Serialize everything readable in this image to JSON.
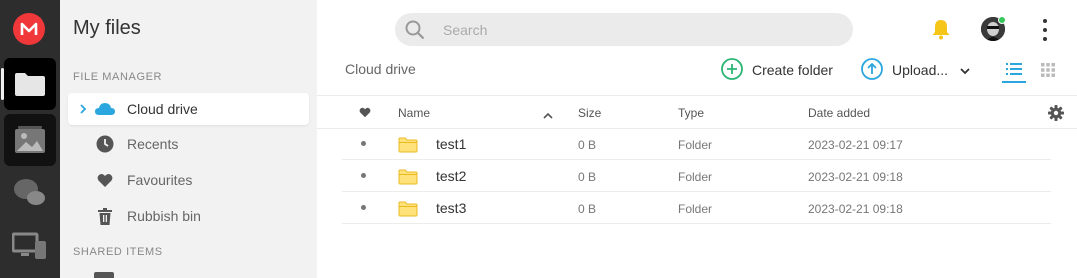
{
  "sidebar": {
    "title": "My files",
    "file_manager_label": "FILE MANAGER",
    "items": [
      {
        "label": "Cloud drive",
        "icon": "cloud-icon"
      },
      {
        "label": "Recents",
        "icon": "clock-icon"
      },
      {
        "label": "Favourites",
        "icon": "heart-icon"
      },
      {
        "label": "Rubbish bin",
        "icon": "trash-icon"
      }
    ],
    "shared_label": "SHARED ITEMS"
  },
  "topbar": {
    "search_placeholder": "Search"
  },
  "toolbar": {
    "breadcrumb": "Cloud drive",
    "create_folder_label": "Create folder",
    "upload_label": "Upload..."
  },
  "table": {
    "columns": {
      "name": "Name",
      "size": "Size",
      "type": "Type",
      "date": "Date added"
    },
    "rows": [
      {
        "name": "test1",
        "size": "0 B",
        "type": "Folder",
        "date": "2023-02-21 09:17"
      },
      {
        "name": "test2",
        "size": "0 B",
        "type": "Folder",
        "date": "2023-02-21 09:18"
      },
      {
        "name": "test3",
        "size": "0 B",
        "type": "Folder",
        "date": "2023-02-21 09:18"
      }
    ]
  },
  "colors": {
    "brand_red": "#f0373a",
    "accent_blue": "#2ba6de",
    "accent_green": "#2bb673",
    "folder_yellow": "#ffd84d",
    "bell_yellow": "#f5c518"
  }
}
